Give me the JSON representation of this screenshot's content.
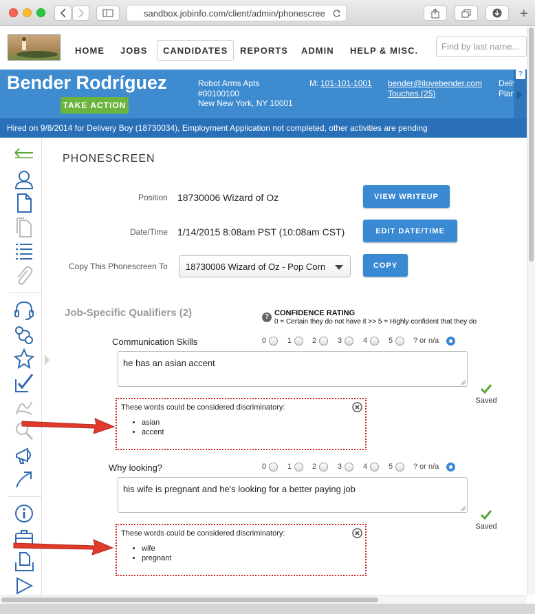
{
  "browser": {
    "url": "sandbox.jobinfo.com/client/admin/phonescree",
    "add_tab": "+"
  },
  "nav": {
    "items": [
      "HOME",
      "JOBS",
      "CANDIDATES",
      "REPORTS",
      "ADMIN",
      "HELP & MISC."
    ],
    "active": "CANDIDATES",
    "search_placeholder": "Find by last name..."
  },
  "candidate": {
    "name": "Bender Rodríguez",
    "action_button": "TAKE ACTION",
    "address_line1": "Robot Arms Apts",
    "address_line2": "#00100100",
    "address_line3": "New New York, NY 10001",
    "phone_label": "M:",
    "phone": "101-101-1001",
    "email": "bender@ilovebender.com",
    "touches": "Touches (25)",
    "extra_1": "Deliv",
    "extra_2": "Plan",
    "help_badge": "?",
    "status_line": "Hired on 9/8/2014 for Delivery Boy (18730034), Employment Application not completed, other activities are pending"
  },
  "phonescreen": {
    "title": "PHONESCREEN",
    "position_label": "Position",
    "position_value": "18730006 Wizard of Oz",
    "view_writeup": "VIEW WRITEUP",
    "datetime_label": "Date/Time",
    "datetime_value": "1/14/2015 8:08am PST (10:08am CST)",
    "edit_datetime": "EDIT DATE/TIME",
    "copy_label": "Copy This Phonescreen To",
    "copy_select": "18730006 Wizard of Oz - Pop Corn",
    "copy_button": "COPY"
  },
  "qualifiers": {
    "title": "Job-Specific Qualifiers (2)",
    "confidence_title": "CONFIDENCE RATING",
    "confidence_desc": "0 = Certain they do not have it >> 5 = Highly confident that they do",
    "help": "?",
    "rating_labels": [
      "0",
      "1",
      "2",
      "3",
      "4",
      "5",
      "? or n/a"
    ],
    "items": [
      {
        "name": "Communication Skills",
        "selected": "? or n/a",
        "answer": "he has an asian accent",
        "saved": "Saved",
        "warning_title": "These words could be considered discriminatory:",
        "words": [
          "asian",
          "accent"
        ]
      },
      {
        "name": "Why looking?",
        "selected": "? or n/a",
        "answer": "his wife is pregnant and he's looking for a better paying job",
        "saved": "Saved",
        "warning_title": "These words could be considered discriminatory:",
        "words": [
          "wife",
          "pregnant"
        ]
      }
    ]
  },
  "colors": {
    "brand_blue": "#3e8bd0",
    "status_bar": "#2a70b8",
    "action_green": "#6bb43e",
    "button_blue": "#3a8ad3",
    "warning_red": "#cc2222",
    "arrow_red": "#e03a2a",
    "saved_check": "#5aa83a"
  }
}
